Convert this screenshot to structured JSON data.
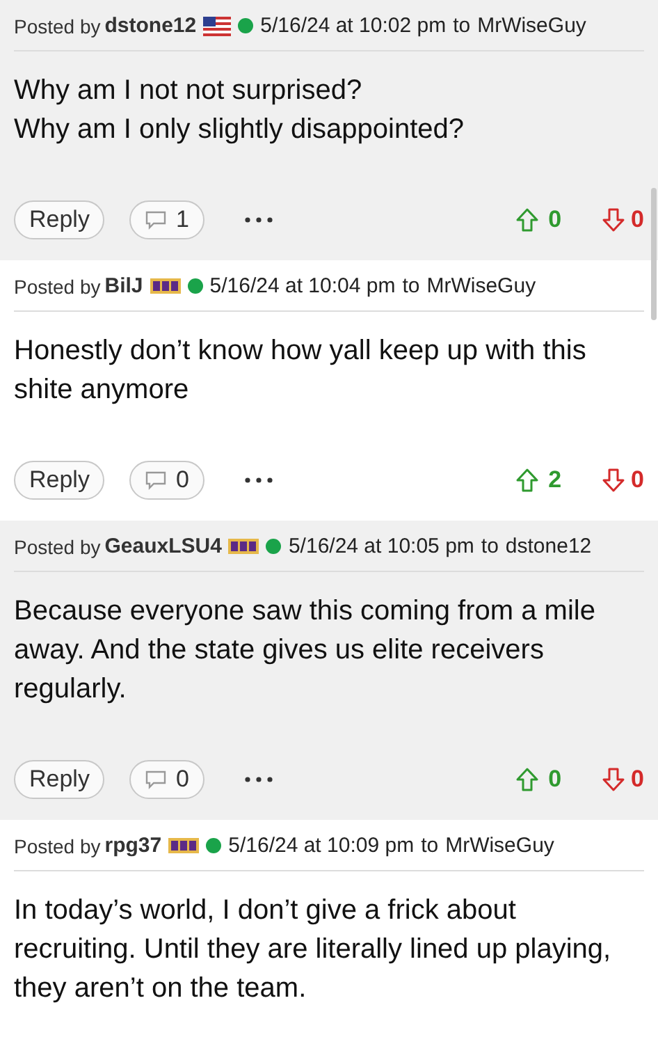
{
  "posts": [
    {
      "posted_by": "Posted by",
      "author": "dstone12",
      "badge": {
        "kind": "flag"
      },
      "online": true,
      "timestamp": "5/16/24 at 10:02 pm",
      "to_label": "to",
      "recipient": "MrWiseGuy",
      "body": [
        "Why am I not not surprised?",
        "Why am I only slightly disappointed?"
      ],
      "footer": {
        "reply": "Reply",
        "comments": "1",
        "upvotes": "0",
        "downvotes": "0"
      }
    },
    {
      "posted_by": "Posted by",
      "author": "BilJ",
      "badge": {
        "kind": "team"
      },
      "online": true,
      "timestamp": "5/16/24 at 10:04 pm",
      "to_label": "to",
      "recipient": "MrWiseGuy",
      "body": [
        "Honestly don’t know how yall keep up with this shite anymore"
      ],
      "footer": {
        "reply": "Reply",
        "comments": "0",
        "upvotes": "2",
        "downvotes": "0"
      }
    },
    {
      "posted_by": "Posted by",
      "author": "GeauxLSU4",
      "badge": {
        "kind": "team"
      },
      "online": true,
      "timestamp": "5/16/24 at 10:05 pm",
      "to_label": "to",
      "recipient": "dstone12",
      "body": [
        "Because everyone saw this coming from a mile away. And the state gives us elite receivers regularly."
      ],
      "footer": {
        "reply": "Reply",
        "comments": "0",
        "upvotes": "0",
        "downvotes": "0"
      }
    },
    {
      "posted_by": "Posted by",
      "author": "rpg37",
      "badge": {
        "kind": "team"
      },
      "online": true,
      "timestamp": "5/16/24 at 10:09 pm",
      "to_label": "to",
      "recipient": "MrWiseGuy",
      "body": [
        "In today’s world, I don’t give a frick about recruiting. Until they are literally lined up playing, they aren’t on the team."
      ]
    }
  ]
}
